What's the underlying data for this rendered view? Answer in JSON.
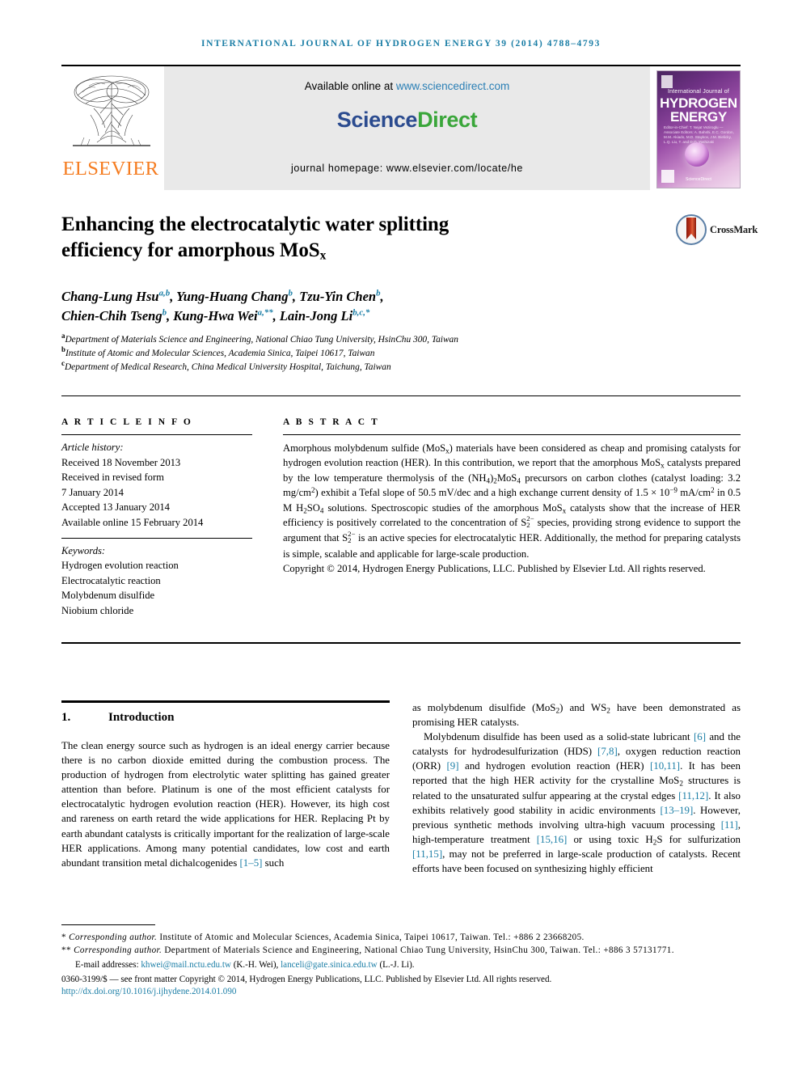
{
  "runhead": "international journal of hydrogen energy 39 (2014) 4788–4793",
  "masthead": {
    "publisher_logo_text": "ELSEVIER",
    "available_online_label": "Available online at",
    "available_online_url": "www.sciencedirect.com",
    "sciencedirect_part1": "Science",
    "sciencedirect_part2": "Direct",
    "journal_homepage": "journal homepage: www.elsevier.com/locate/he",
    "cover": {
      "line_small": "International Journal of",
      "line_big1": "HYDROGEN",
      "line_big2": "ENERGY",
      "editors": "Editor-in-Chief: T. Nejat Veziroglu — Associate Editors: A. Bahshi, E.C. Gordon, M.M. Akiado, M.D. Staykov, J.M. Bielicky, L.Q. Liu, T. and D.O. Yoshizaki",
      "sciencedirect_mark": "ScienceDirect"
    }
  },
  "article": {
    "title_line1": "Enhancing the electrocatalytic water splitting",
    "title_line2_pre": "efficiency for amorphous MoS",
    "title_line2_sub": "x",
    "crossmark_label": "CrossMark",
    "authors_line1": "Chang-Lung Hsu",
    "authors": [
      {
        "name": "Chang-Lung Hsu",
        "marks": "a,b",
        "sep": ", "
      },
      {
        "name": "Yung-Huang Chang",
        "marks": "b",
        "sep": ", "
      },
      {
        "name": "Tzu-Yin Chen",
        "marks": "b",
        "sep": ","
      },
      {
        "name": "Chien-Chih Tseng",
        "marks": "b",
        "sep": ", "
      },
      {
        "name": "Kung-Hwa Wei",
        "marks": "a,**",
        "sep": ", "
      },
      {
        "name": "Lain-Jong Li",
        "marks": "b,c,*",
        "sep": ""
      }
    ],
    "affiliations": [
      {
        "mark": "a",
        "text": "Department of Materials Science and Engineering, National Chiao Tung University, HsinChu 300, Taiwan"
      },
      {
        "mark": "b",
        "text": "Institute of Atomic and Molecular Sciences, Academia Sinica, Taipei 10617, Taiwan"
      },
      {
        "mark": "c",
        "text": "Department of Medical Research, China Medical University Hospital, Taichung, Taiwan"
      }
    ]
  },
  "article_info": {
    "heading": "A R T I C L E   I N F O",
    "history_label": "Article history:",
    "history": [
      "Received 18 November 2013",
      "Received in revised form",
      "7 January 2014",
      "Accepted 13 January 2014",
      "Available online 15 February 2014"
    ],
    "keywords_label": "Keywords:",
    "keywords": [
      "Hydrogen evolution reaction",
      "Electrocatalytic reaction",
      "Molybdenum disulfide",
      "Niobium chloride"
    ]
  },
  "abstract": {
    "heading": "A B S T R A C T",
    "copyright": "Copyright © 2014, Hydrogen Energy Publications, LLC. Published by Elsevier Ltd. All rights reserved."
  },
  "introduction": {
    "number": "1.",
    "heading": "Introduction"
  },
  "footnotes": {
    "star1_mark": "*",
    "star1_italic": "Corresponding author.",
    "star1_text": " Institute of Atomic and Molecular Sciences, Academia Sinica, Taipei 10617, Taiwan. Tel.: +886 2 23668205.",
    "star2_mark": "**",
    "star2_italic": "Corresponding author.",
    "star2_text": " Department of Materials Science and Engineering, National Chiao Tung University, HsinChu 300, Taiwan. Tel.: +886 3 57131771.",
    "email_label": "E-mail addresses:",
    "email1": "khwei@mail.nctu.edu.tw",
    "email1_owner": "(K.-H. Wei)",
    "email2": "lanceli@gate.sinica.edu.tw",
    "email2_owner": "(L.-J. Li).",
    "issn_line": "0360-3199/$ — see front matter Copyright © 2014, Hydrogen Energy Publications, LLC. Published by Elsevier Ltd. All rights reserved.",
    "doi": "http://dx.doi.org/10.1016/j.ijhydene.2014.01.090"
  },
  "colors": {
    "link": "#1b7ea6",
    "elsevier_orange": "#f57c20",
    "sciencedirect_blue": "#2b4b8f",
    "sciencedirect_green": "#3aa63a",
    "band_gray": "#e9e9e9"
  }
}
